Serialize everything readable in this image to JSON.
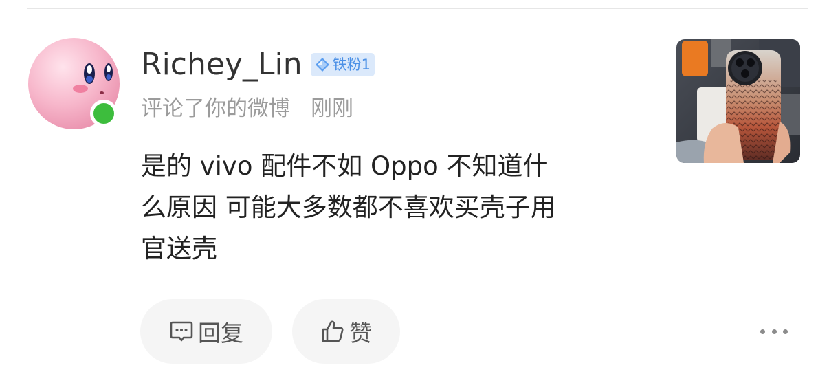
{
  "comment": {
    "username": "Richey_Lin",
    "fan_badge": {
      "label": "铁粉1",
      "icon": "diamond-icon",
      "color": "#4b90e6"
    },
    "action_text": "评论了你的微博",
    "time": "刚刚",
    "content_lines": [
      "是的 vivo 配件不如 Oppo 不知道什",
      "么原因 可能大多数都不喜欢买壳子用",
      "官送壳"
    ],
    "online_status_color": "#3dbd3d"
  },
  "actions": {
    "reply_label": "回复",
    "reply_icon": "comment-bubble-icon",
    "like_label": "赞",
    "like_icon": "thumbs-up-icon",
    "more_icon": "more-dots-icon"
  }
}
